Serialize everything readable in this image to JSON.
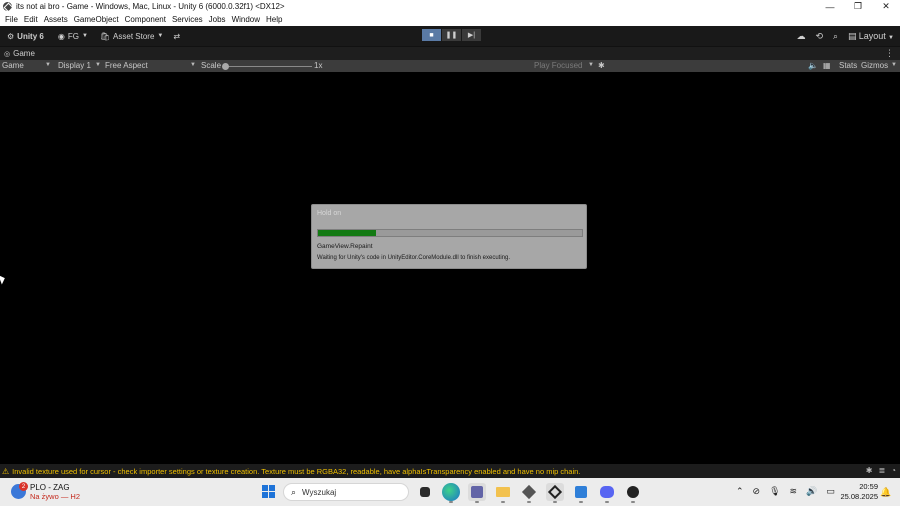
{
  "window": {
    "title": "its not ai bro - Game - Windows, Mac, Linux - Unity 6 (6000.0.32f1) <DX12>",
    "controls": [
      "—",
      "❐",
      "✕"
    ]
  },
  "menu": [
    "File",
    "Edit",
    "Assets",
    "GameObject",
    "Component",
    "Services",
    "Jobs",
    "Window",
    "Help"
  ],
  "toolbar": {
    "unity_label": "Unity 6",
    "account_label": "FG",
    "asset_store_label": "Asset Store",
    "layout_label": "Layout"
  },
  "tab": {
    "label": "Game"
  },
  "game_toolbar": {
    "mode": "Game",
    "display": "Display 1",
    "aspect": "Free Aspect",
    "scale_label": "Scale",
    "scale_value": "1x",
    "play_focused": "Play Focused",
    "stats": "Stats",
    "gizmos": "Gizmos"
  },
  "dialog": {
    "title": "Hold on",
    "progress": 0.22,
    "step": "GameView.Repaint",
    "message": "Waiting for Unity's code in UnityEditor.CoreModule.dll to finish executing."
  },
  "status": {
    "message": "Invalid texture used for cursor - check importer settings or texture creation. Texture must be RGBA32, readable, have alphaIsTransparency enabled and have no mip chain."
  },
  "taskbar": {
    "notification_title": "PLO - ZAG",
    "notification_subtitle": "Na żywo — H2",
    "notification_badge": "2",
    "search_placeholder": "Wyszukaj",
    "time": "20:59",
    "date": "25.08.2025"
  },
  "colors": {
    "progress_fill": "#137a13",
    "warning": "#f0c000",
    "accent": "#1e73d8"
  }
}
